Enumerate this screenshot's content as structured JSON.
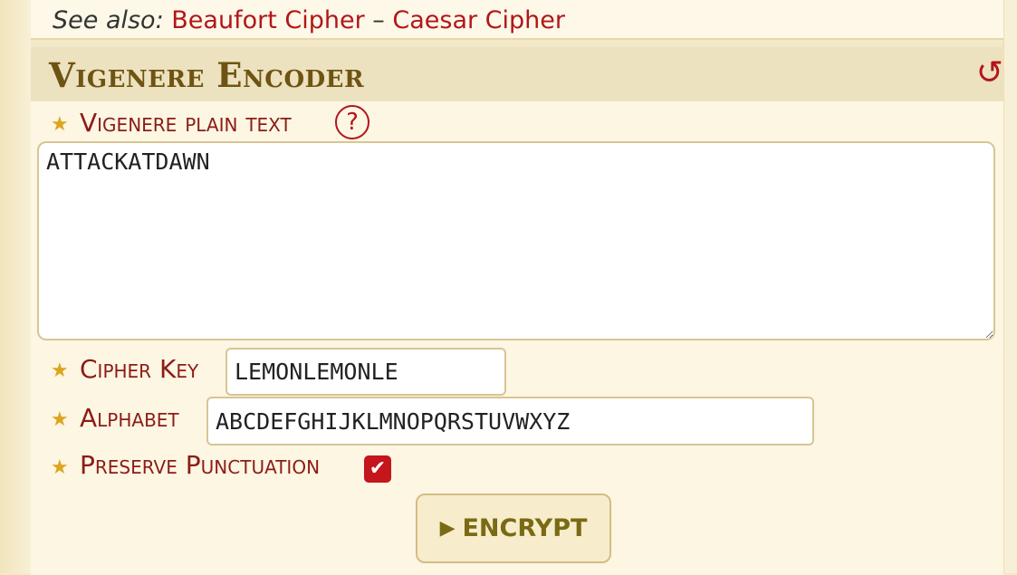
{
  "see_also": {
    "label": "See also:",
    "links": [
      "Beaufort Cipher",
      "Caesar Cipher"
    ],
    "separator": "–"
  },
  "tool": {
    "title": "Vigenere Encoder",
    "reset_icon": "reset-icon",
    "plaintext": {
      "label": "Vigenere plain text",
      "help_icon": "?",
      "value": "ATTACKATDAWN"
    },
    "cipher_key": {
      "label": "Cipher Key",
      "value": "LEMONLEMONLE"
    },
    "alphabet": {
      "label": "Alphabet",
      "value": "ABCDEFGHIJKLMNOPQRSTUVWXYZ"
    },
    "preserve_punctuation": {
      "label": "Preserve Punctuation",
      "checked": true
    },
    "encrypt_button": {
      "icon": "▶",
      "label": "ENCRYPT"
    }
  },
  "colors": {
    "accent_red": "#b2161a",
    "label_red": "#8c1c17",
    "title_brown": "#6e5413",
    "star_gold": "#dca51e",
    "button_text": "#7a6a14"
  }
}
